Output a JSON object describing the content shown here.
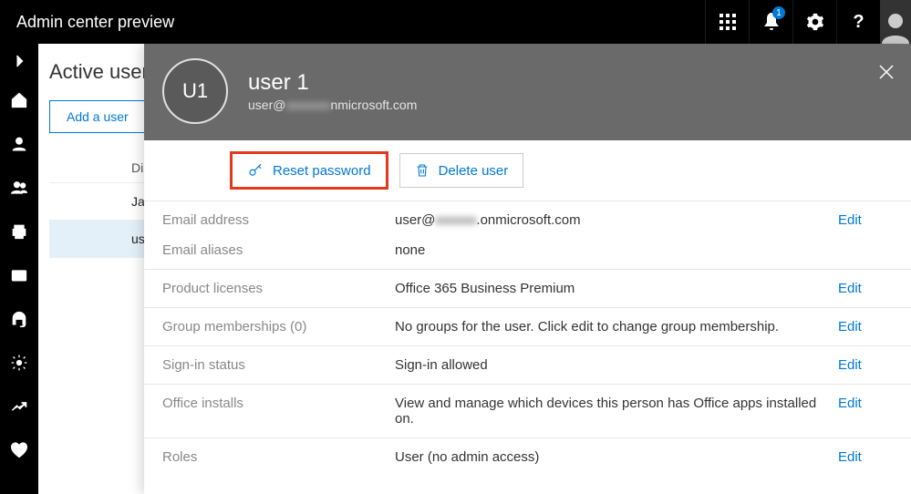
{
  "topbar": {
    "title": "Admin center preview",
    "notification_count": "1"
  },
  "page": {
    "title": "Active users",
    "add_user_label": "Add a user",
    "column_header": "Display name",
    "rows": [
      {
        "name": "Jag"
      },
      {
        "name": "user"
      }
    ]
  },
  "panel": {
    "avatar_initials": "U1",
    "display_name": "user 1",
    "email_prefix": "user@",
    "email_blur": "xxxxxxx",
    "email_suffix": "nmicrosoft.com",
    "actions": {
      "reset_password": "Reset password",
      "delete_user": "Delete user"
    },
    "details": {
      "email_label": "Email address",
      "email_value_prefix": "user@",
      "email_value_blur": "xxxxxx",
      "email_value_suffix": ".onmicrosoft.com",
      "aliases_label": "Email aliases",
      "aliases_value": "none",
      "licenses_label": "Product licenses",
      "licenses_value": "Office 365 Business Premium",
      "groups_label": "Group memberships (0)",
      "groups_value": "No groups for the user. Click edit to change group membership.",
      "signin_label": "Sign-in status",
      "signin_value": "Sign-in allowed",
      "installs_label": "Office installs",
      "installs_value": "View and manage which devices this person has Office apps installed on.",
      "roles_label": "Roles",
      "roles_value": "User (no admin access)",
      "edit_label": "Edit"
    }
  }
}
